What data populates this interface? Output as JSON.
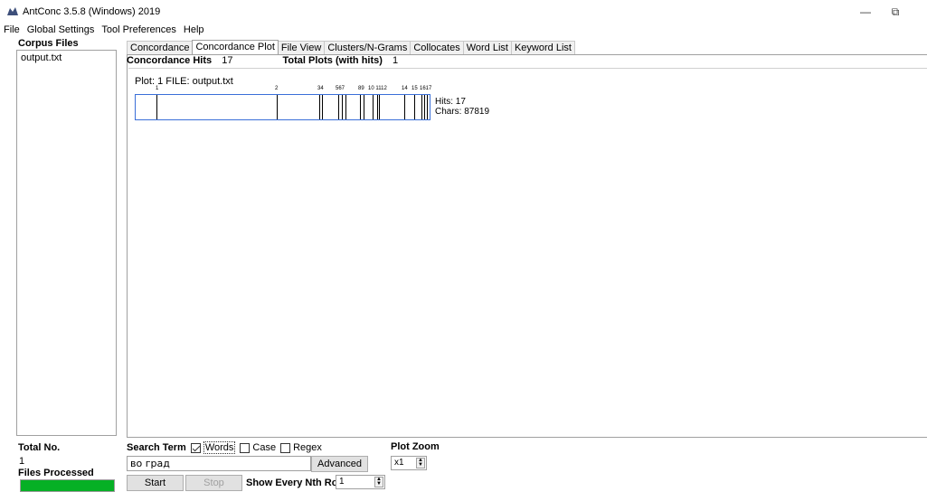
{
  "window": {
    "title": "AntConc 3.5.8 (Windows) 2019",
    "minimize_glyph": "—",
    "restore_glyph": "⧉"
  },
  "menu": [
    "File",
    "Global Settings",
    "Tool Preferences",
    "Help"
  ],
  "corpus": {
    "heading": "Corpus Files",
    "files": [
      "output.txt"
    ]
  },
  "tabs": [
    "Concordance",
    "Concordance Plot",
    "File View",
    "Clusters/N-Grams",
    "Collocates",
    "Word List",
    "Keyword List"
  ],
  "stats": {
    "hits_label": "Concordance Hits",
    "hits_value": "17",
    "plots_label": "Total Plots (with hits)",
    "plots_value": "1"
  },
  "plot": {
    "header": "Plot: 1   FILE: output.txt",
    "hits_text": "Hits: 17",
    "chars_text": "Chars: 87819",
    "hit_labels": [
      "1",
      "2",
      "34",
      "567",
      "89",
      "10 1112",
      "14",
      "15",
      "1617"
    ]
  },
  "status": {
    "total_no_label": "Total No.",
    "total_no_value": "1",
    "files_processed_label": "Files Processed"
  },
  "search": {
    "term_label": "Search Term",
    "words_label": "Words",
    "case_label": "Case",
    "regex_label": "Regex",
    "value": "во град",
    "advanced_label": "Advanced",
    "start_label": "Start",
    "stop_label": "Stop",
    "nth_row_label": "Show Every Nth Row",
    "nth_row_value": "1"
  },
  "zoom": {
    "label": "Plot Zoom",
    "value": "x1"
  }
}
